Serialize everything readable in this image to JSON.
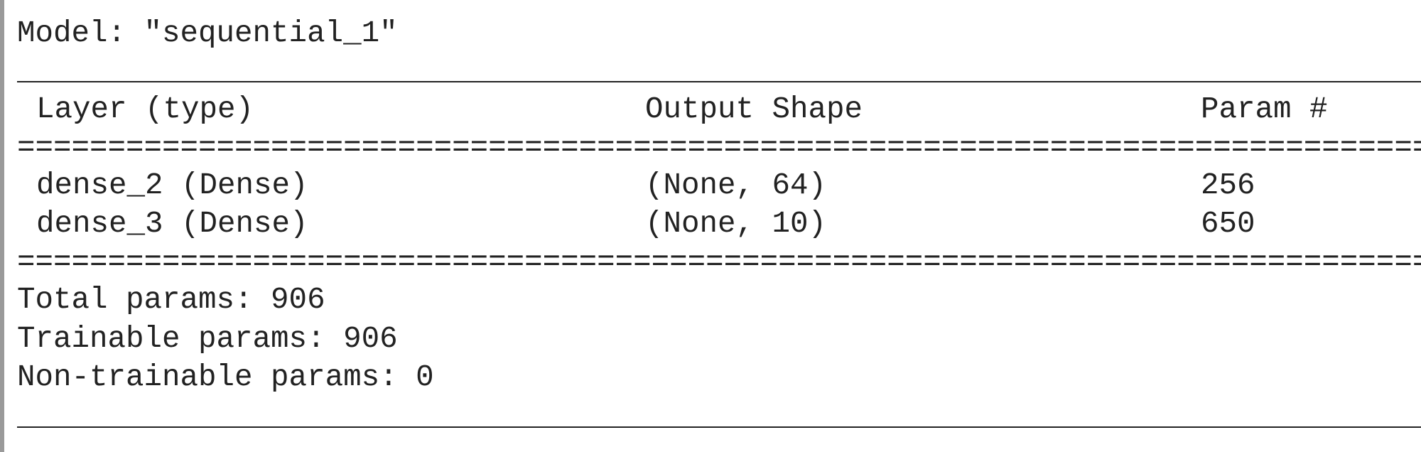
{
  "model_title": "Model: \"sequential_1\"",
  "headers": {
    "layer": "Layer (type)",
    "output_shape": "Output Shape",
    "params": "Param #"
  },
  "separator": "==============================================================================",
  "layers": [
    {
      "name": "dense_2 (Dense)",
      "output_shape": "(None, 64)",
      "params": "256"
    },
    {
      "name": "dense_3 (Dense)",
      "output_shape": "(None, 10)",
      "params": "650"
    }
  ],
  "summary": {
    "total": "Total params: 906",
    "trainable": "Trainable params: 906",
    "non_trainable": "Non-trainable params: 0"
  }
}
